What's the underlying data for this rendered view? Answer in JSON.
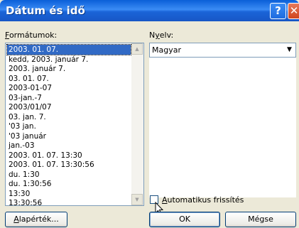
{
  "window": {
    "title": "Dátum és idő",
    "help": "?",
    "close": "✕"
  },
  "formats": {
    "label_u": "F",
    "label_rest": "ormátumok:",
    "items": [
      "2003. 01. 07.",
      "kedd, 2003. január 7.",
      "2003. január 7.",
      "03. 01. 07.",
      "2003-01-07",
      "03-jan.-7",
      "2003/01/07",
      "03. jan. 7.",
      "'03 jan.",
      "'03 január",
      "jan.-03",
      "2003. 01. 07. 13:30",
      "2003. 01. 07. 13:30:56",
      "du. 1:30",
      "du. 1:30:56",
      "13:30",
      "13:30:56"
    ],
    "selected_index": 0
  },
  "language": {
    "label_pre": "N",
    "label_u": "y",
    "label_rest": "elv:",
    "value": "Magyar"
  },
  "auto_update": {
    "label_u": "A",
    "label_rest": "utomatikus frissítés",
    "checked": false
  },
  "buttons": {
    "default_u": "A",
    "default_rest": "lapérték...",
    "ok": "OK",
    "cancel": "Mégse"
  }
}
